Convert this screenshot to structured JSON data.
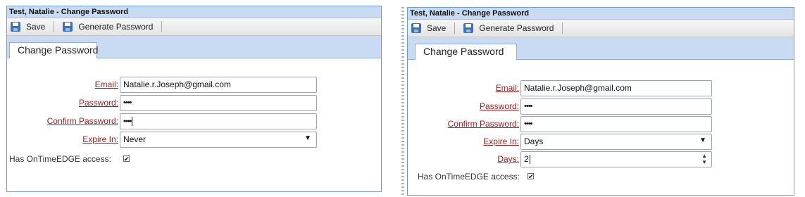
{
  "left": {
    "title": "Test, Natalie - Change Password",
    "toolbar": {
      "save": "Save",
      "generate": "Generate Password"
    },
    "tab": "Change Password",
    "form": {
      "email_label": "Email:",
      "email_value": "Natalie.r.Joseph@gmail.com",
      "password_label": "Password:",
      "password_value": "••••",
      "confirm_label": "Confirm Password:",
      "confirm_value": "••••",
      "expire_label": "Expire In:",
      "expire_value": "Never",
      "access_label": "Has OnTimeEDGE access:",
      "access_checked": "✔"
    }
  },
  "right": {
    "title": "Test, Natalie - Change Password",
    "toolbar": {
      "save": "Save",
      "generate": "Generate Password"
    },
    "tab": "Change Password",
    "form": {
      "email_label": "Email:",
      "email_value": "Natalie.r.Joseph@gmail.com",
      "password_label": "Password:",
      "password_value": "••••",
      "confirm_label": "Confirm Password:",
      "confirm_value": "••••",
      "expire_label": "Expire In:",
      "expire_value": "Days",
      "days_label": "Days:",
      "days_value": "2",
      "access_label": "Has OnTimeEDGE access:",
      "access_checked": "✔"
    }
  },
  "icons": {
    "select_arrow": "▼",
    "spin_up": "▲",
    "spin_down": "▼"
  }
}
